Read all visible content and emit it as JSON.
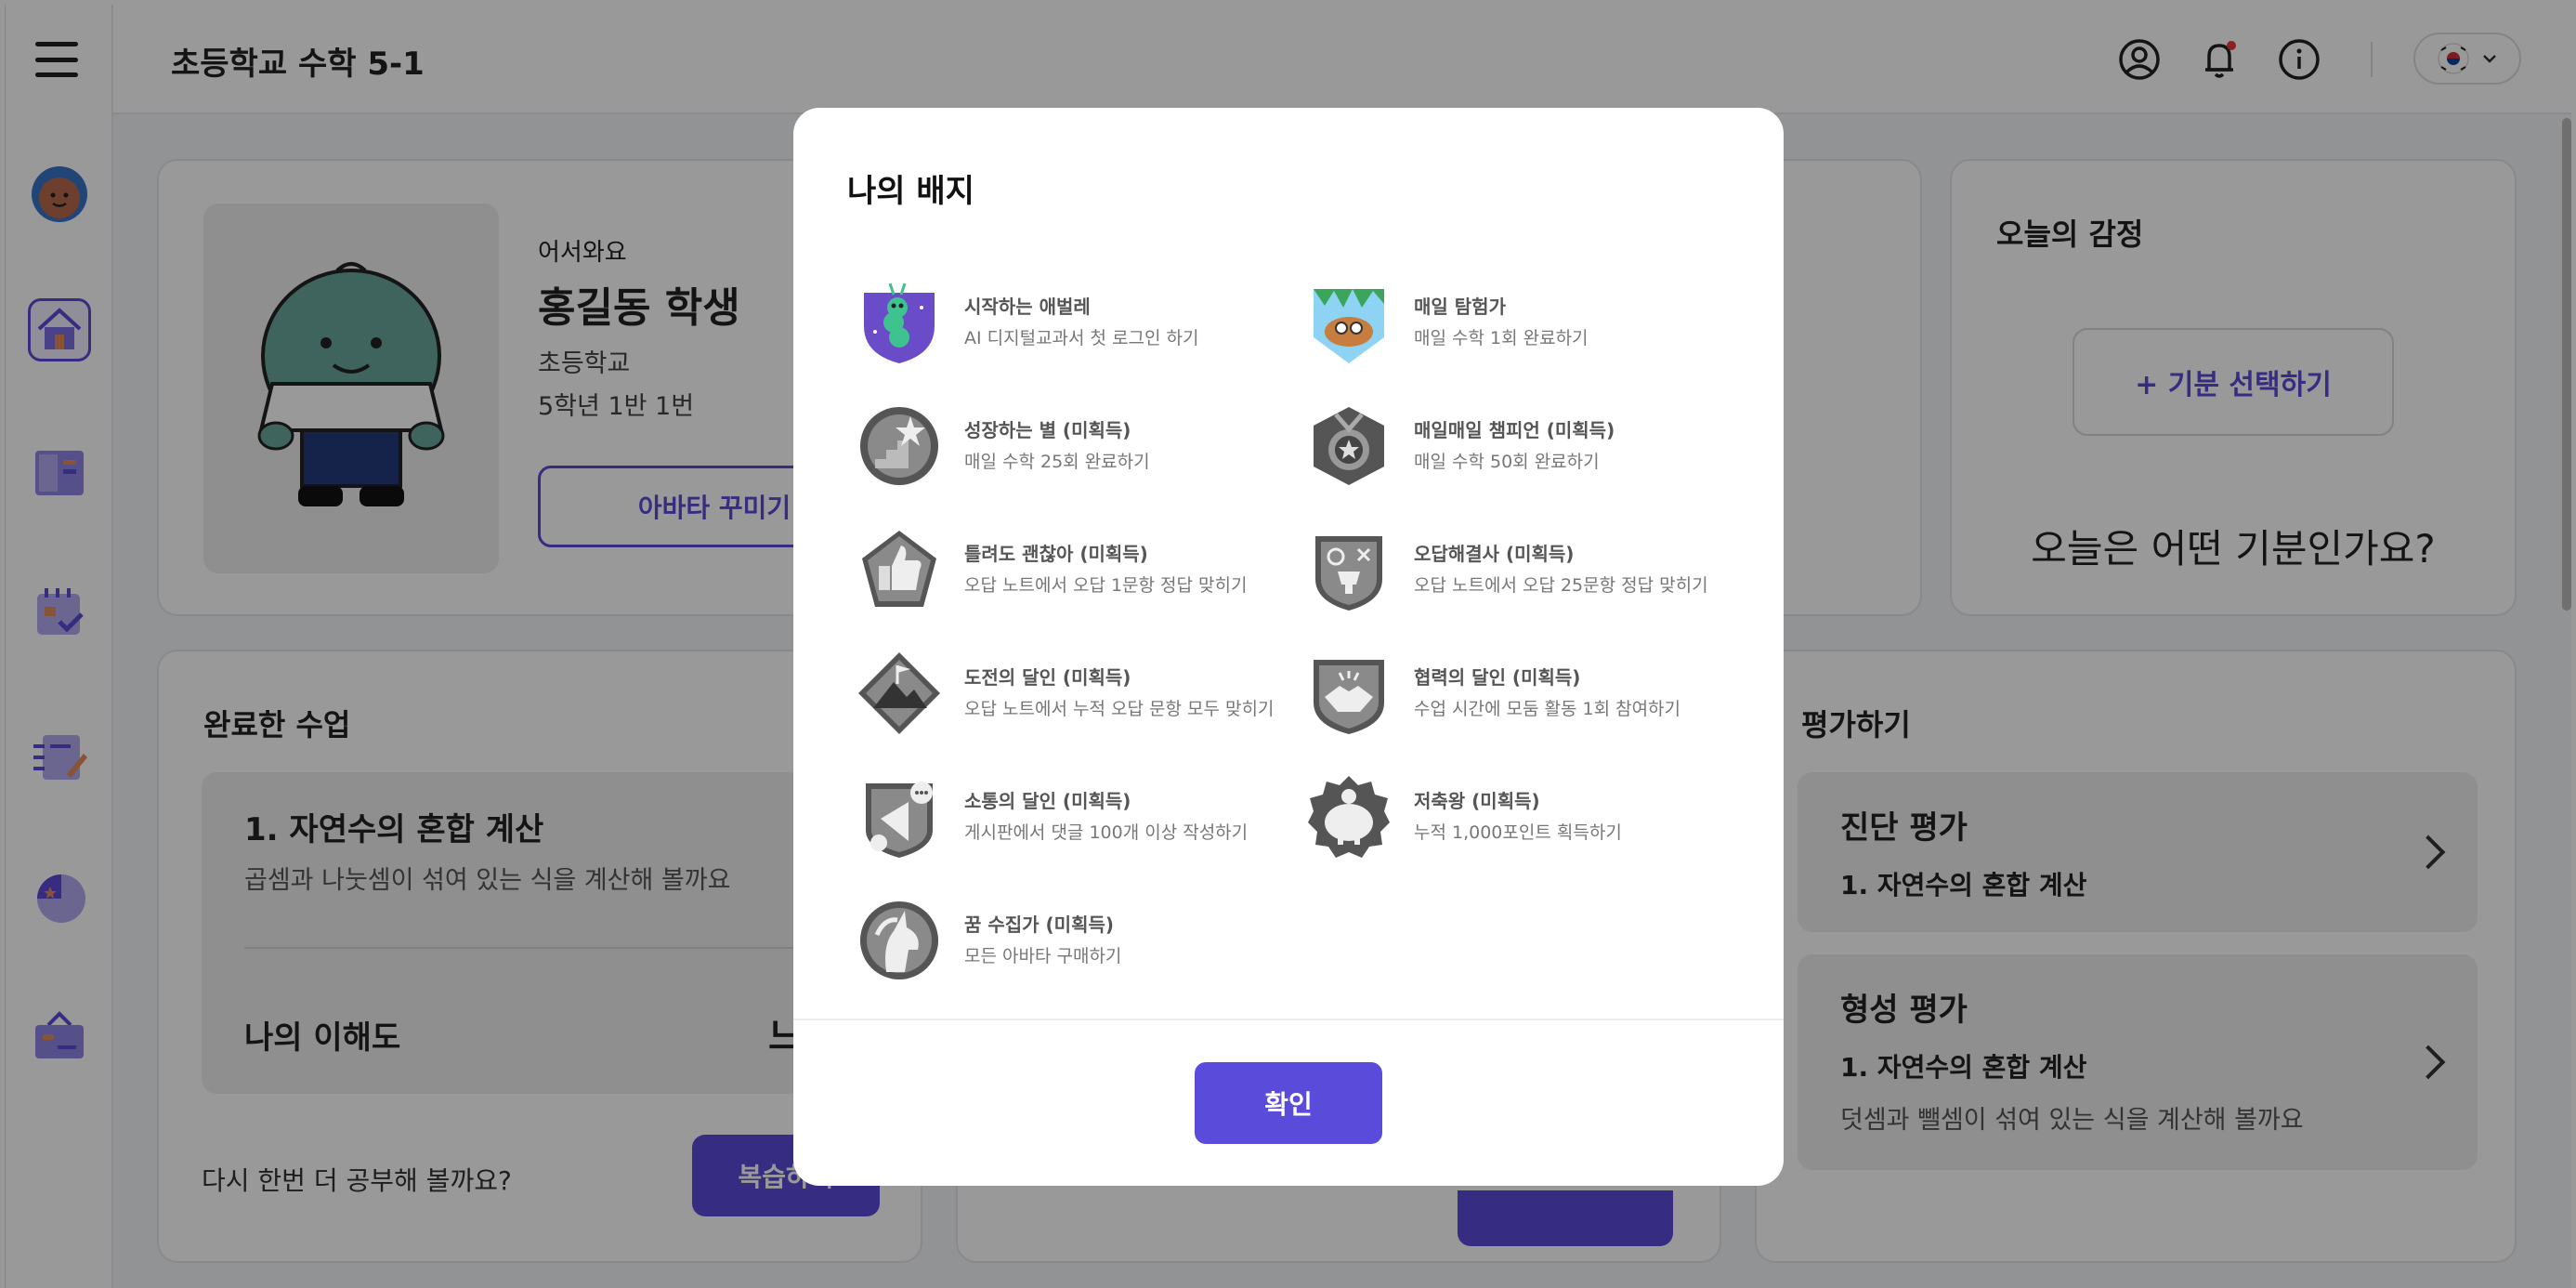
{
  "header": {
    "title": "초등학교 수학 5-1",
    "icons": [
      "account-circle-icon",
      "bell-icon",
      "info-icon"
    ],
    "notification_dot_color": "#e53935",
    "language_flag": "korea-flag-icon"
  },
  "sidebar": {
    "menu_icon": "hamburger-menu-icon",
    "items": [
      "avatar",
      "home",
      "textbook",
      "calendar-check",
      "notebook-edit",
      "pie-chart",
      "briefcase"
    ]
  },
  "profile": {
    "greeting": "어서와요",
    "name": "홍길동 학생",
    "school": "초등학교",
    "class": "5학년 1반 1번",
    "avatar_button": "아바타 꾸미기",
    "help": "?"
  },
  "emotion": {
    "title": "오늘의 감정",
    "select_button": "+ 기분 선택하기",
    "question": "오늘은 어떤 기분인가요?"
  },
  "completed": {
    "title": "완료한 수업",
    "lesson_title": "1. 자연수의 혼합 계산",
    "lesson_desc": "곱셈과 나눗셈이 섞여 있는 식을 계산해 볼까요",
    "understanding_label": "나의 이해도",
    "understanding_value": "느",
    "review_prompt": "다시 한번 더 공부해 볼까요?",
    "review_button": "복습하기"
  },
  "evaluation": {
    "title": "평가하기",
    "items": [
      {
        "title": "진단 평가",
        "subtitle": "1. 자연수의 혼합 계산",
        "desc": ""
      },
      {
        "title": "형성 평가",
        "subtitle": "1. 자연수의 혼합 계산",
        "desc": "덧셈과 뺄셈이 섞여 있는 식을 계산해 볼까요"
      }
    ]
  },
  "modal": {
    "title": "나의 배지",
    "confirm": "확인",
    "badges": [
      {
        "name": "시작하는 애벌레",
        "desc": "AI 디지털교과서 첫 로그인 하기",
        "icon": "caterpillar-badge-icon"
      },
      {
        "name": "매일 탐험가",
        "desc": "매일 수학 1회 완료하기",
        "icon": "explorer-badge-icon"
      },
      {
        "name": "성장하는 별 (미획득)",
        "desc": "매일 수학 25회 완료하기",
        "icon": "star-stairs-badge-icon"
      },
      {
        "name": "매일매일 챔피언 (미획득)",
        "desc": "매일 수학 50회 완료하기",
        "icon": "champion-medal-badge-icon"
      },
      {
        "name": "틀려도 괜찮아 (미획득)",
        "desc": "오답 노트에서 오답 1문항 정답 맞히기",
        "icon": "thumbs-up-badge-icon"
      },
      {
        "name": "오답해결사 (미획득)",
        "desc": "오답 노트에서 오답 25문항 정답 맞히기",
        "icon": "trophy-badge-icon"
      },
      {
        "name": "도전의 달인 (미획득)",
        "desc": "오답 노트에서 누적 오답 문항 모두 맞히기",
        "icon": "mountain-flag-badge-icon"
      },
      {
        "name": "협력의 달인 (미획득)",
        "desc": "수업 시간에 모둠 활동 1회 참여하기",
        "icon": "handshake-badge-icon"
      },
      {
        "name": "소통의 달인 (미획득)",
        "desc": "게시판에서 댓글 100개 이상 작성하기",
        "icon": "megaphone-badge-icon"
      },
      {
        "name": "저축왕 (미획득)",
        "desc": "누적 1,000포인트 획득하기",
        "icon": "piggy-bank-badge-icon"
      },
      {
        "name": "꿈 수집가 (미획득)",
        "desc": "모든 아바타 구매하기",
        "icon": "unicorn-badge-icon"
      }
    ]
  },
  "colors": {
    "accent": "#5b4bdb",
    "overlay": "rgba(0,0,0,0.40)"
  }
}
